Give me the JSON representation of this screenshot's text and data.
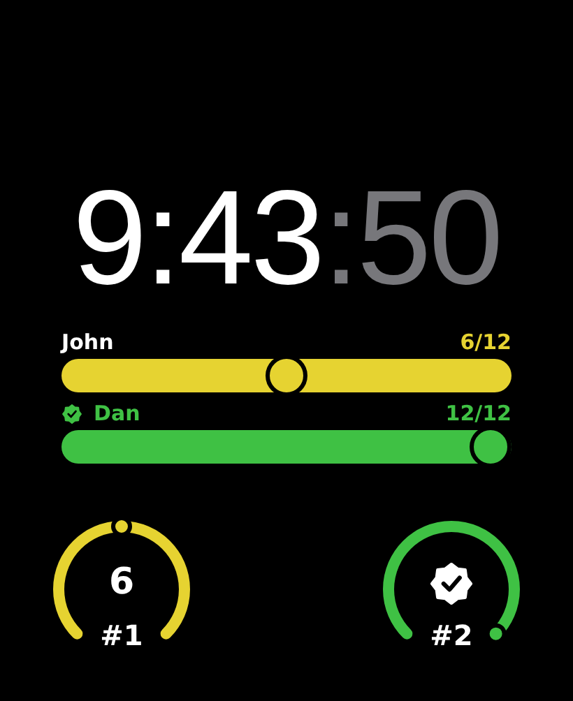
{
  "clock": {
    "time": "9:43",
    "seconds": ":50"
  },
  "players": [
    {
      "name": "John",
      "score": "6/12",
      "level": 0.5,
      "color": "#e6d331",
      "verified": false
    },
    {
      "name": "Dan",
      "score": "12/12",
      "level": 1,
      "color": "#3fc144",
      "verified": true
    }
  ],
  "gauges": [
    {
      "kind": "number",
      "value": "6",
      "rank": "#1",
      "color": "#e6d331"
    },
    {
      "kind": "badge",
      "rank": "#2",
      "color": "#3fc144"
    }
  ]
}
